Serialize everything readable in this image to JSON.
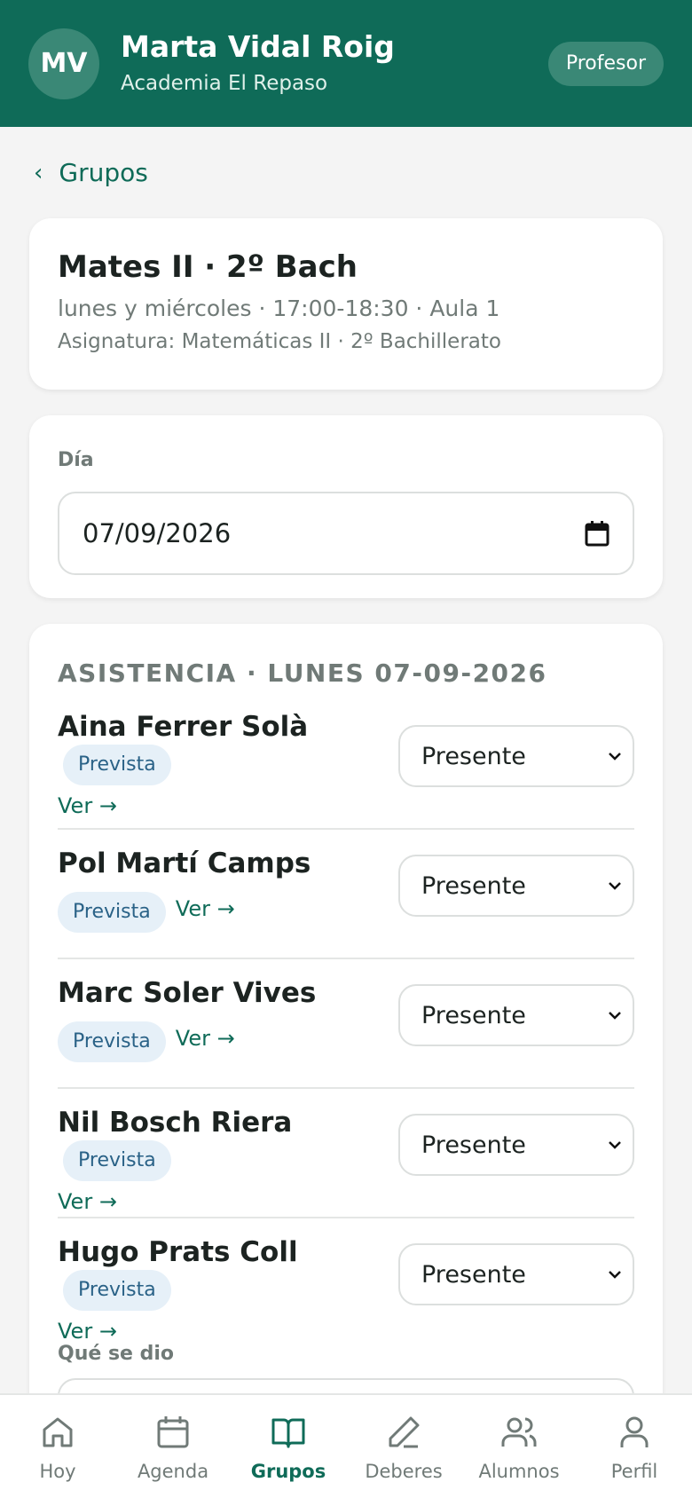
{
  "header": {
    "initials": "MV",
    "name": "Marta Vidal Roig",
    "organization": "Academia El Repaso",
    "role": "Profesor"
  },
  "back": {
    "label": "Grupos"
  },
  "group": {
    "title": "Mates II · 2º Bach",
    "schedule": "lunes y miércoles · 17:00-18:30 · Aula 1",
    "subject": "Asignatura: Matemáticas II · 2º Bachillerato"
  },
  "day": {
    "label": "Día",
    "value": "07/09/2026"
  },
  "attendance": {
    "title": "ASISTENCIA · LUNES 07-09-2026",
    "students": [
      {
        "name": "Aina Ferrer Solà",
        "badge": "Prevista",
        "link": "Ver →",
        "status": "Presente"
      },
      {
        "name": "Pol Martí Camps",
        "badge": "Prevista",
        "link": "Ver →",
        "status": "Presente"
      },
      {
        "name": "Marc Soler Vives",
        "badge": "Prevista",
        "link": "Ver →",
        "status": "Presente"
      },
      {
        "name": "Nil Bosch Riera",
        "badge": "Prevista",
        "link": "Ver →",
        "status": "Presente"
      },
      {
        "name": "Hugo Prats Coll",
        "badge": "Prevista",
        "link": "Ver →",
        "status": "Presente"
      }
    ],
    "notes_label": "Qué se dio"
  },
  "nav": {
    "items": [
      {
        "label": "Hoy",
        "icon": "home-icon"
      },
      {
        "label": "Agenda",
        "icon": "calendar-icon"
      },
      {
        "label": "Grupos",
        "icon": "book-icon",
        "active": true
      },
      {
        "label": "Deberes",
        "icon": "pencil-icon"
      },
      {
        "label": "Alumnos",
        "icon": "users-icon"
      },
      {
        "label": "Perfil",
        "icon": "user-icon"
      }
    ]
  },
  "colors": {
    "brand": "#0f6b58",
    "badge_bg": "#e6f0f8",
    "badge_text": "#2a6287"
  }
}
